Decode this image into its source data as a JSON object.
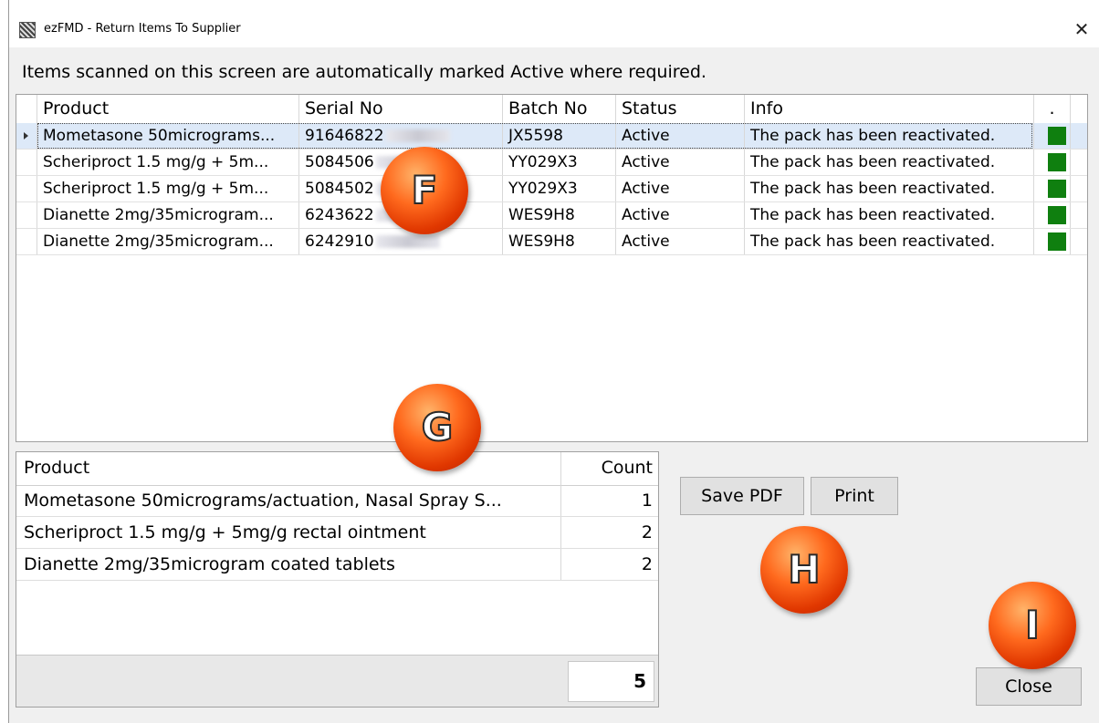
{
  "window": {
    "title": "ezFMD - Return Items To Supplier",
    "close_symbol": "✕"
  },
  "instruction": "Items scanned on this screen are automatically marked Active where required.",
  "items_grid": {
    "columns": [
      "Product",
      "Serial No",
      "Batch No",
      "Status",
      "Info",
      "."
    ],
    "rows": [
      {
        "product": "Mometasone 50micrograms...",
        "serial": "91646822",
        "batch": "JX5598",
        "status": "Active",
        "info": "The pack has been reactivated.",
        "status_color": "#0f7f0f",
        "selected": true
      },
      {
        "product": "Scheriproct 1.5 mg/g + 5m...",
        "serial": "5084506",
        "batch": "YY029X3",
        "status": "Active",
        "info": "The pack has been reactivated.",
        "status_color": "#0f7f0f",
        "selected": false
      },
      {
        "product": "Scheriproct 1.5 mg/g + 5m...",
        "serial": "5084502",
        "batch": "YY029X3",
        "status": "Active",
        "info": "The pack has been reactivated.",
        "status_color": "#0f7f0f",
        "selected": false
      },
      {
        "product": "Dianette 2mg/35microgram...",
        "serial": "6243622",
        "batch": "WES9H8",
        "status": "Active",
        "info": "The pack has been reactivated.",
        "status_color": "#0f7f0f",
        "selected": false
      },
      {
        "product": "Dianette 2mg/35microgram...",
        "serial": "6242910",
        "batch": "WES9H8",
        "status": "Active",
        "info": "The pack has been reactivated.",
        "status_color": "#0f7f0f",
        "selected": false
      }
    ]
  },
  "summary_grid": {
    "columns": [
      "Product",
      "Count"
    ],
    "rows": [
      {
        "product": "Mometasone 50micrograms/actuation, Nasal Spray S...",
        "count": "1"
      },
      {
        "product": "Scheriproct 1.5 mg/g + 5mg/g rectal ointment",
        "count": "2"
      },
      {
        "product": "Dianette 2mg/35microgram coated tablets",
        "count": "2"
      }
    ],
    "total": "5"
  },
  "buttons": {
    "save_pdf": "Save PDF",
    "print": "Print",
    "close": "Close"
  },
  "markers": {
    "f": "F",
    "g": "G",
    "h": "H",
    "i": "I"
  }
}
